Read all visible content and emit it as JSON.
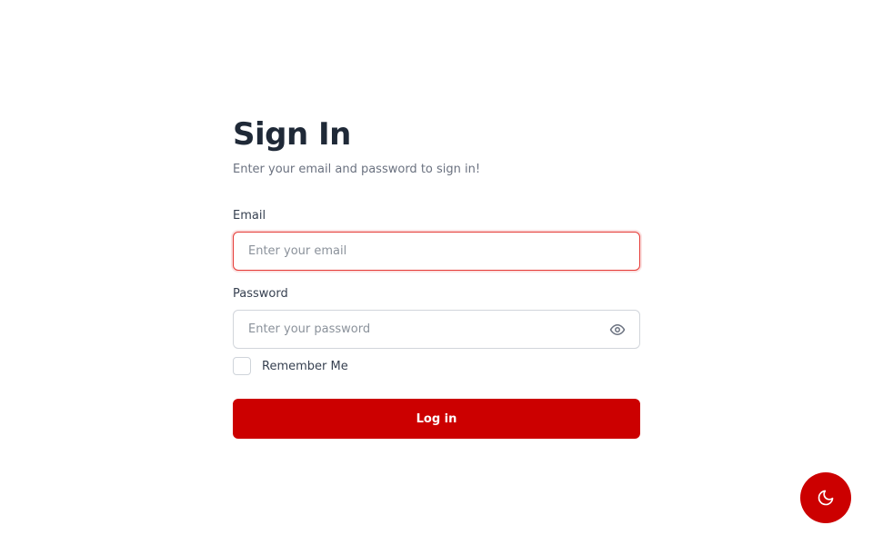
{
  "login": {
    "title": "Sign In",
    "subtitle": "Enter your email and password to sign in!",
    "email": {
      "label": "Email",
      "placeholder": "Enter your email",
      "value": ""
    },
    "password": {
      "label": "Password",
      "placeholder": "Enter your password",
      "value": ""
    },
    "remember_me": {
      "label": "Remember Me",
      "checked": false
    },
    "submit_label": "Log in"
  },
  "theme_toggle": {
    "icon": "moon-icon"
  },
  "colors": {
    "accent": "#cc0000",
    "focus_border": "#e53935",
    "text_dark": "#1f2937",
    "text_muted": "#6b7280",
    "input_border": "#d1d5db"
  }
}
